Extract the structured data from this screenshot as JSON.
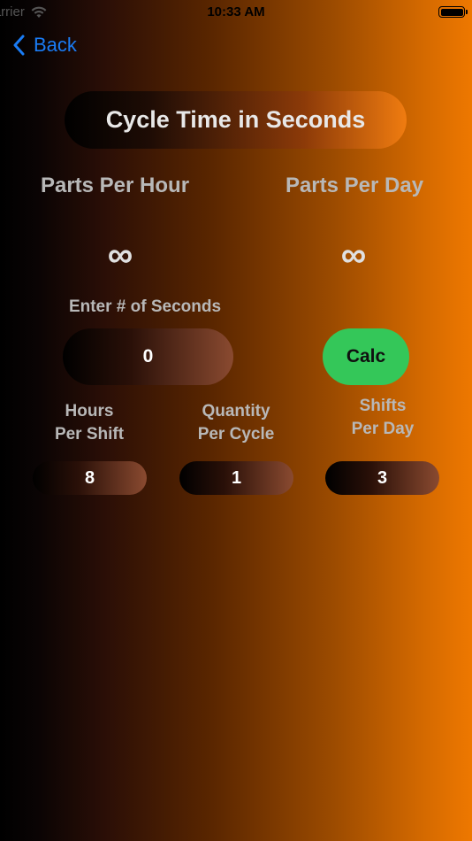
{
  "status_bar": {
    "carrier": "Carrier",
    "time": "10:33 AM"
  },
  "nav": {
    "back_label": "Back"
  },
  "header": {
    "title": "Cycle Time in Seconds"
  },
  "results": {
    "parts_per_hour_label": "Parts Per Hour",
    "parts_per_hour_value": "∞",
    "parts_per_day_label": "Parts Per Day",
    "parts_per_day_value": "∞"
  },
  "seconds": {
    "label": "Enter # of Seconds",
    "value": "0"
  },
  "calc_button": {
    "label": "Calc",
    "color": "#34c759"
  },
  "fields": {
    "hours_per_shift": {
      "label_line1": "Hours",
      "label_line2": "Per Shift",
      "value": "8"
    },
    "quantity_per_cycle": {
      "label_line1": "Quantity",
      "label_line2": "Per Cycle",
      "value": "1"
    },
    "shifts_per_day": {
      "label_line1": "Shifts",
      "label_line2": "Per Day",
      "value": "3"
    }
  },
  "colors": {
    "accent": "#1a7cf5",
    "gradient_end": "#ee7800"
  }
}
